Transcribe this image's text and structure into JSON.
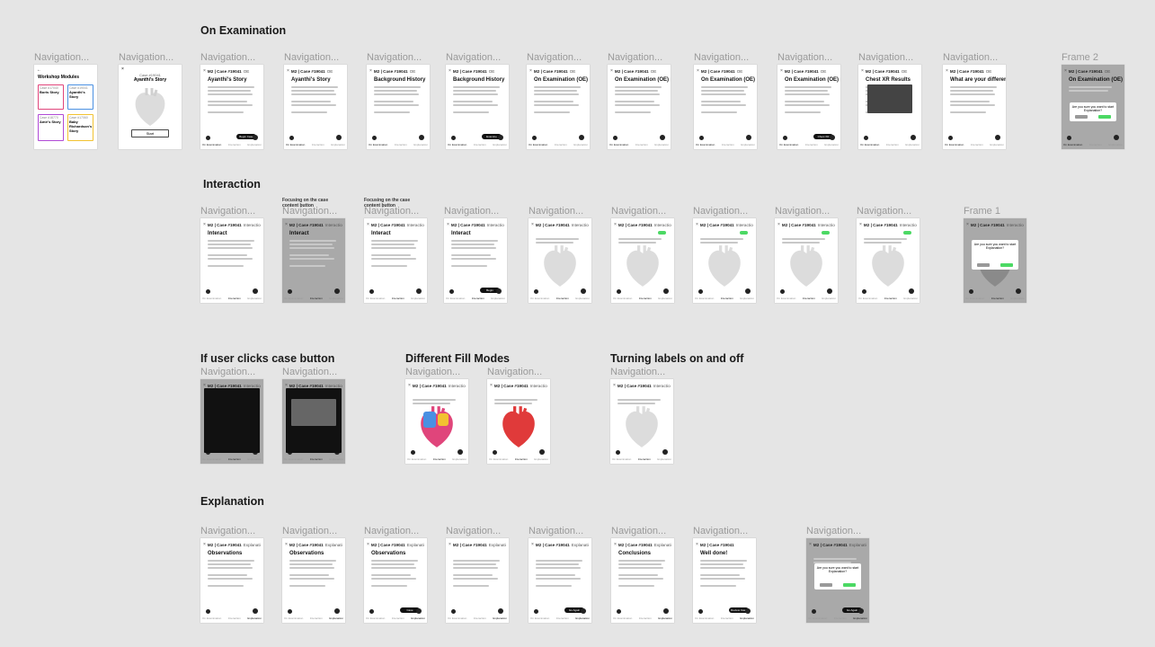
{
  "sections": {
    "on_examination": "On Examination",
    "interaction": "Interaction",
    "case_button": "If user clicks case button",
    "fill_modes": "Different Fill Modes",
    "labels": "Turning labels on and off",
    "explanation": "Explanation"
  },
  "frame_label": "Navigation...",
  "frame2_label": "Frame 2",
  "frame1_label": "Frame 1",
  "note_focus": "Focusing on the case content button",
  "header_case": "M2 | Case #19041",
  "header_oe": "OE",
  "header_interaction": "Interaction",
  "header_explanation": "Explanation",
  "tabs": [
    "On Examination",
    "Interaction",
    "Explanation"
  ],
  "workshop": {
    "title": "Workshop Modules",
    "cards": [
      {
        "case": "Case #17040",
        "name": "Boris Story",
        "color": "#e0457b"
      },
      {
        "case": "Case #19041",
        "name": "Ayanthi's Story",
        "color": "#4a90e2"
      },
      {
        "case": "Case #18770",
        "name": "Amir's Story",
        "color": "#b04ad6"
      },
      {
        "case": "Case #17060",
        "name": "Baby Richardson's Story",
        "color": "#f2c230"
      }
    ]
  },
  "intro": {
    "case": "Case #19041",
    "name": "Ayanthi's Story",
    "button": "Start"
  },
  "oe_titles": [
    "Ayanthi's Story",
    "Ayanthi's Story",
    "Background History",
    "Background History",
    "On Examination (OE)",
    "On Examination (OE)",
    "On Examination (OE)",
    "On Examination (OE)",
    "Chest XR Results",
    "What are your differential diagnoses?",
    "On Examination (OE)"
  ],
  "oe_buttons": {
    "begin": "Begin Case",
    "examine": "Examine",
    "chest": "Chest XR Results"
  },
  "interaction_titles": [
    "Interact",
    "Interact",
    "Interact",
    "Interact"
  ],
  "interaction_button": "Begin Interaction",
  "explanation_titles": [
    "Observations",
    "Observations",
    "Observations",
    "",
    "",
    "Conclusions",
    "Well done!"
  ],
  "explanation_buttons": {
    "case_breakdown": "Case Breakdown",
    "review": "Review Case",
    "go": "Go Again"
  },
  "modal": {
    "question": "Are you sure you want to start Explanation?",
    "no": "No",
    "yes": "Yes"
  },
  "colors": {
    "accent_green": "#4cd964",
    "dark": "#111111",
    "frame_grey": "#a9a9a9"
  }
}
